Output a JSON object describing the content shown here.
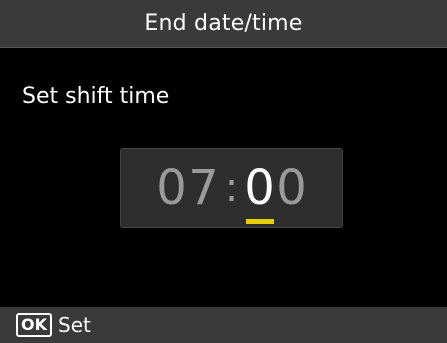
{
  "header": {
    "title": "End date/time"
  },
  "main": {
    "prompt": "Set shift time",
    "time": {
      "hour_tens": "0",
      "hour_ones": "7",
      "separator": ":",
      "minute_tens": "0",
      "minute_ones": "0",
      "active_field": "minute_tens"
    }
  },
  "footer": {
    "key_label": "OK",
    "action_label": "Set"
  },
  "colors": {
    "title_bar": "#3a3a3a",
    "background": "#000000",
    "inactive_digit": "#9a9a9a",
    "active_digit": "#ffffff",
    "cursor_underline": "#e8d000"
  }
}
